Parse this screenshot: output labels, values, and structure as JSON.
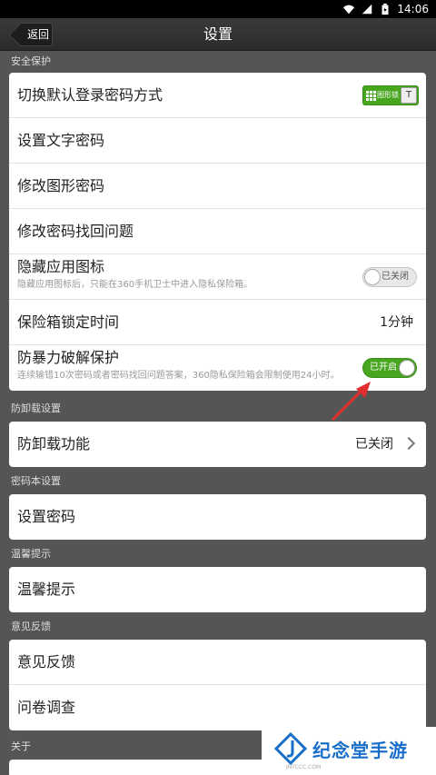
{
  "status_bar": {
    "time": "14:06"
  },
  "title_bar": {
    "back_label": "返回",
    "title": "设置"
  },
  "sections": {
    "security": {
      "header": "安全保护",
      "switch_login": {
        "label": "切换默认登录密码方式",
        "mode_text": "图形锁",
        "knob_text": "T"
      },
      "set_text_password": {
        "label": "设置文字密码"
      },
      "change_pattern": {
        "label": "修改图形密码"
      },
      "change_recovery": {
        "label": "修改密码找回问题"
      },
      "hide_icon": {
        "label": "隐藏应用图标",
        "sub": "隐藏应用图标后，只能在360手机卫士中进入隐私保险箱。",
        "toggle_text": "已关闭",
        "enabled": false
      },
      "lock_time": {
        "label": "保险箱锁定时间",
        "value": "1分钟"
      },
      "brute_force": {
        "label": "防暴力破解保护",
        "sub": "连续输错10次密码或者密码找回问题答案，360隐私保险箱会限制使用24小时。",
        "toggle_text": "已开启",
        "enabled": true
      }
    },
    "uninstall": {
      "header": "防卸载设置",
      "item": {
        "label": "防卸载功能",
        "value": "已关闭"
      }
    },
    "notebook": {
      "header": "密码本设置",
      "item": {
        "label": "设置密码"
      }
    },
    "tips": {
      "header": "温馨提示",
      "item": {
        "label": "温馨提示"
      }
    },
    "feedback": {
      "header": "意见反馈",
      "feedback_item": {
        "label": "意见反馈"
      },
      "survey_item": {
        "label": "问卷调查"
      }
    },
    "about": {
      "header": "关于"
    }
  },
  "watermark": {
    "text": "纪念堂手游",
    "sub": "JNTCCC.COM"
  },
  "colors": {
    "toggle_on": "#47a51e",
    "annotation_arrow": "#e03030"
  },
  "icons": [
    "wifi-icon",
    "signal-icon",
    "battery-icon",
    "grid-icon",
    "chevron-right-icon",
    "annotation-arrow-icon"
  ]
}
